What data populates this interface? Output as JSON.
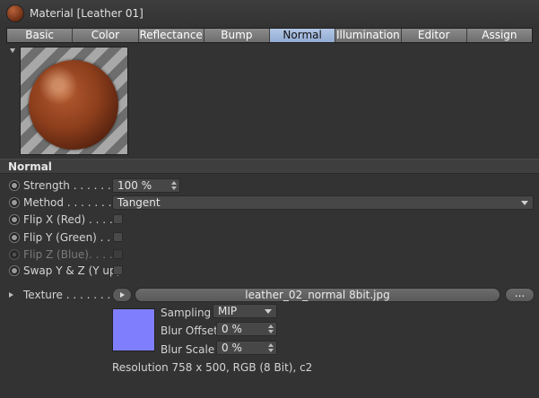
{
  "header": {
    "title": "Material [Leather 01]"
  },
  "tabs": [
    {
      "label": "Basic"
    },
    {
      "label": "Color"
    },
    {
      "label": "Reflectance"
    },
    {
      "label": "Bump"
    },
    {
      "label": "Normal",
      "active": true
    },
    {
      "label": "Illumination"
    },
    {
      "label": "Editor"
    },
    {
      "label": "Assign"
    }
  ],
  "section": {
    "title": "Normal"
  },
  "params": {
    "strength": {
      "label": "Strength . . . . . . . .",
      "value": "100 %"
    },
    "method": {
      "label": "Method . . . . . . . . .",
      "value": "Tangent"
    },
    "flip_x": {
      "label": "Flip X (Red) . . . . .",
      "checked": false
    },
    "flip_y": {
      "label": "Flip Y (Green) . . . .",
      "checked": false
    },
    "flip_z": {
      "label": "Flip Z (Blue). . . . .",
      "checked": false,
      "disabled": true
    },
    "swap_yz": {
      "label": "Swap Y & Z (Y up)",
      "checked": false
    }
  },
  "texture": {
    "label": "Texture . . . . . . . . .",
    "filename": "leather_02_normal 8bit.jpg",
    "more_label": "...",
    "swatch_color": "#7f7ffd",
    "sampling": {
      "label": "Sampling",
      "value": "MIP"
    },
    "blur_offset": {
      "label": "Blur Offset",
      "value": "0 %"
    },
    "blur_scale": {
      "label": "Blur Scale",
      "value": "0 %"
    },
    "resolution": "Resolution 758 x 500, RGB (8 Bit), c2"
  },
  "colors": {
    "panel_bg": "#333333",
    "active_tab": "#a3bbe0",
    "material": "#8c3e1c"
  }
}
